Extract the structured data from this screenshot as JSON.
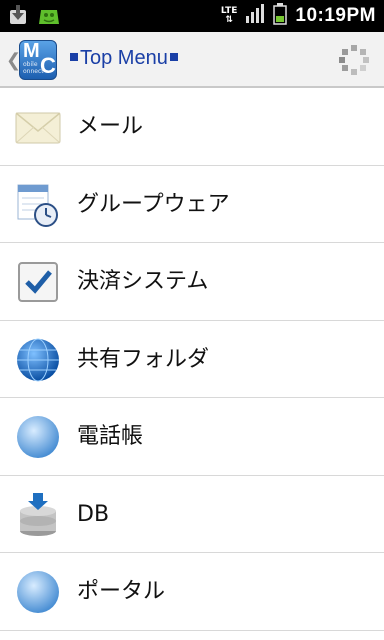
{
  "status_bar": {
    "time": "10:19PM",
    "network": "LTE",
    "icons": [
      "download-icon",
      "android-icon",
      "lte-icon",
      "signal-icon",
      "battery-icon"
    ]
  },
  "app_bar": {
    "logo_letters": [
      "M",
      "C"
    ],
    "logo_small_text": [
      "obile",
      "onnect"
    ],
    "title": "Top Menu",
    "icons": [
      "back-chevron-icon",
      "app-logo",
      "loading-spinner-icon"
    ]
  },
  "menu": {
    "items": [
      {
        "label": "メール",
        "icon": "envelope-icon"
      },
      {
        "label": "グループウェア",
        "icon": "calendar-clock-icon"
      },
      {
        "label": "決済システム",
        "icon": "checkbox-icon"
      },
      {
        "label": "共有フォルダ",
        "icon": "globe-icon"
      },
      {
        "label": "電話帳",
        "icon": "globe-light-icon"
      },
      {
        "label": "DB",
        "icon": "database-icon"
      },
      {
        "label": "ポータル",
        "icon": "globe-light-icon"
      }
    ]
  },
  "colors": {
    "title": "#1a3fa6",
    "status_bar_bg": "#000000",
    "app_bar_bg": "#f2f2f2",
    "divider": "#d8d8d8"
  }
}
